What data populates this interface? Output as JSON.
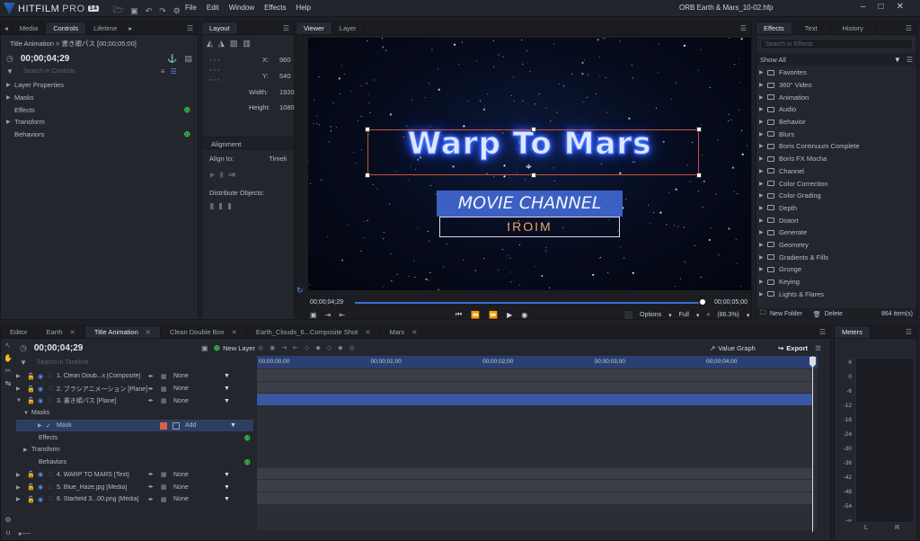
{
  "app": {
    "name": "HITFILM",
    "edition": "PRO",
    "version": "14",
    "file_title": "ORB Earth & Mars_10-02.hfp"
  },
  "menu": [
    "File",
    "Edit",
    "Window",
    "Effects",
    "Help"
  ],
  "left_panel": {
    "tabs": [
      "Media",
      "Controls",
      "Lifetime"
    ],
    "active_tab": "Controls",
    "breadcrumb": "Title Animation > 書き順パス [00;00;05;00]",
    "timecode": "00;00;04;29",
    "search_placeholder": "Search in Controls",
    "items": [
      "Layer Properties",
      "Masks",
      "Effects",
      "Transform",
      "Behaviors"
    ]
  },
  "layout_panel": {
    "tab": "Layout",
    "x_label": "X:",
    "x_value": "960",
    "y_label": "Y:",
    "y_value": "540",
    "width_label": "Width:",
    "width_value": "1920",
    "height_label": "Height:",
    "height_value": "1080",
    "alignment_label": "Alignment",
    "align_to_label": "Align to:",
    "align_to_value": "Timeli",
    "distribute_label": "Distribute Objects:"
  },
  "viewer": {
    "tabs": [
      "Viewer",
      "Layer"
    ],
    "active_tab": "Viewer",
    "title_text": "Warp To Mars",
    "movie_channel": "MOVIE CHANNEL",
    "iroim": "IROIM",
    "timecode_left": "00;00;04;29",
    "timecode_right": "00;00;05;00",
    "progress": 0.995,
    "options_label": "Options",
    "quality": "Full",
    "zoom": "(86.3%)"
  },
  "effects_panel": {
    "tabs": [
      "Effects",
      "Text",
      "History"
    ],
    "active_tab": "Effects",
    "search_placeholder": "Search in Effects",
    "filter": "Show All",
    "items": [
      "Favorites",
      "360° Video",
      "Animation",
      "Audio",
      "Behavior",
      "Blurs",
      "Boris Continuum Complete",
      "Boris FX Mocha",
      "Channel",
      "Color Correction",
      "Color Grading",
      "Depth",
      "Distort",
      "Generate",
      "Geometry",
      "Gradients & Fills",
      "Grunge",
      "Keying",
      "Lights & Flares"
    ],
    "new_folder": "New Folder",
    "delete": "Delete",
    "count": "864 item(s)"
  },
  "editor": {
    "tabs": [
      "Editor",
      "Earth",
      "Title Animation",
      "Clean Double Box",
      "Earth_Clouds_6...Composite Shot",
      "Mars"
    ],
    "active_tab": "Title Animation",
    "timecode": "00;00;04;29",
    "new_layer": "New Layer",
    "value_graph": "Value Graph",
    "export": "Export",
    "search_placeholder": "Search in Timeline",
    "ruler": [
      "00;00;00;00",
      "00;00;01;00",
      "00;00;02;00",
      "00;00;03;00",
      "00;00;04;00"
    ],
    "layers": [
      {
        "name": "1. Clean Doub...x [Composite]",
        "blend": "None"
      },
      {
        "name": "2. ブラシアニメーション [Plane]",
        "blend": "None"
      },
      {
        "name": "3. 書き順パス [Plane]",
        "blend": "None"
      }
    ],
    "masks_label": "Masks",
    "mask_name": "Mask",
    "mask_mode": "Add",
    "sub_items": [
      "Effects",
      "Transform",
      "Behaviors"
    ],
    "layers_bottom": [
      {
        "name": "4. WARP TO MARS [Text]",
        "blend": "None"
      },
      {
        "name": "5. Blue_Haze.jpg [Media]",
        "blend": "None"
      },
      {
        "name": "6. Starfield 3...00.png [Media]",
        "blend": "None"
      }
    ]
  },
  "meters": {
    "title": "Meters",
    "scale": [
      "6",
      "0",
      "-6",
      "-12",
      "-18",
      "-24",
      "-30",
      "-36",
      "-42",
      "-48",
      "-54",
      "-∞"
    ],
    "channels": [
      "L",
      "R"
    ]
  },
  "colors": {
    "accent": "#3c6fd6",
    "panel": "#23262d",
    "selection": "#2e3e62",
    "green": "#3ac24a"
  }
}
